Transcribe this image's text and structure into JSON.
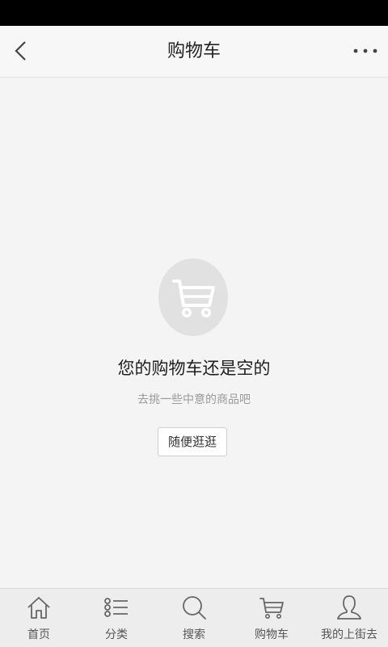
{
  "header": {
    "title": "购物车"
  },
  "empty_state": {
    "title": "您的购物车还是空的",
    "subtitle": "去挑一些中意的商品吧",
    "button_label": "随便逛逛"
  },
  "tab_bar": {
    "items": [
      {
        "label": "首页",
        "icon": "home-icon"
      },
      {
        "label": "分类",
        "icon": "list-icon"
      },
      {
        "label": "搜索",
        "icon": "search-icon"
      },
      {
        "label": "购物车",
        "icon": "cart-icon"
      },
      {
        "label": "我的上街去",
        "icon": "user-icon"
      }
    ]
  },
  "colors": {
    "status_bar": "#000000",
    "background": "#f4f4f4",
    "icon_circle": "#e1e1e1"
  }
}
